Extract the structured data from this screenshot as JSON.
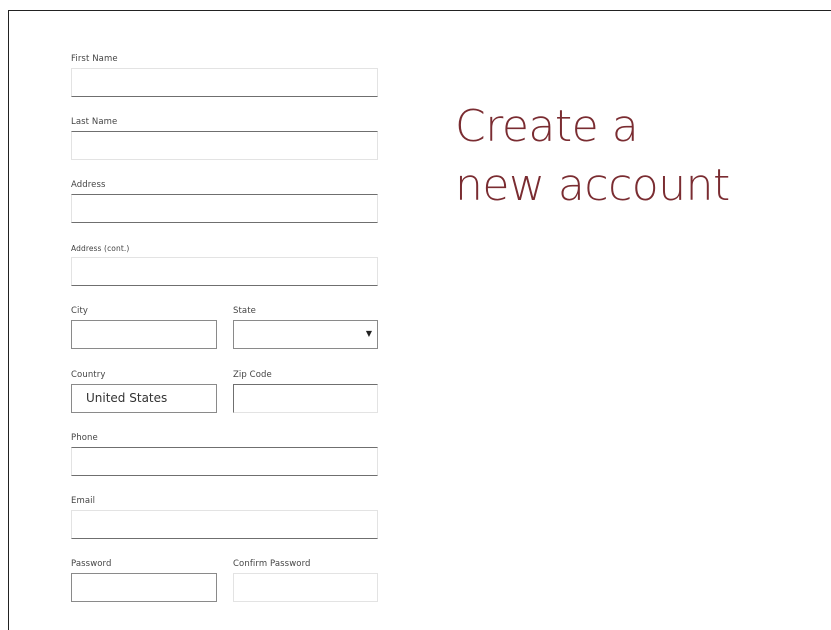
{
  "heading": {
    "line1": "Create a",
    "line2": "new account"
  },
  "form": {
    "first_name": {
      "label": "First Name",
      "value": ""
    },
    "last_name": {
      "label": "Last Name",
      "value": ""
    },
    "address": {
      "label": "Address",
      "value": ""
    },
    "address_cont": {
      "label": "Address (cont.)",
      "value": ""
    },
    "city": {
      "label": "City",
      "value": ""
    },
    "state": {
      "label": "State",
      "value": ""
    },
    "country": {
      "label": "Country",
      "value": "United States"
    },
    "zip": {
      "label": "Zip Code",
      "value": ""
    },
    "phone": {
      "label": "Phone",
      "value": ""
    },
    "email": {
      "label": "Email",
      "value": ""
    },
    "password": {
      "label": "Password",
      "value": ""
    },
    "confirm_password": {
      "label": "Confirm Password",
      "value": ""
    }
  },
  "colors": {
    "heading": "#7a2c31",
    "label": "#444444",
    "input_underline": "#6f6f6f"
  }
}
